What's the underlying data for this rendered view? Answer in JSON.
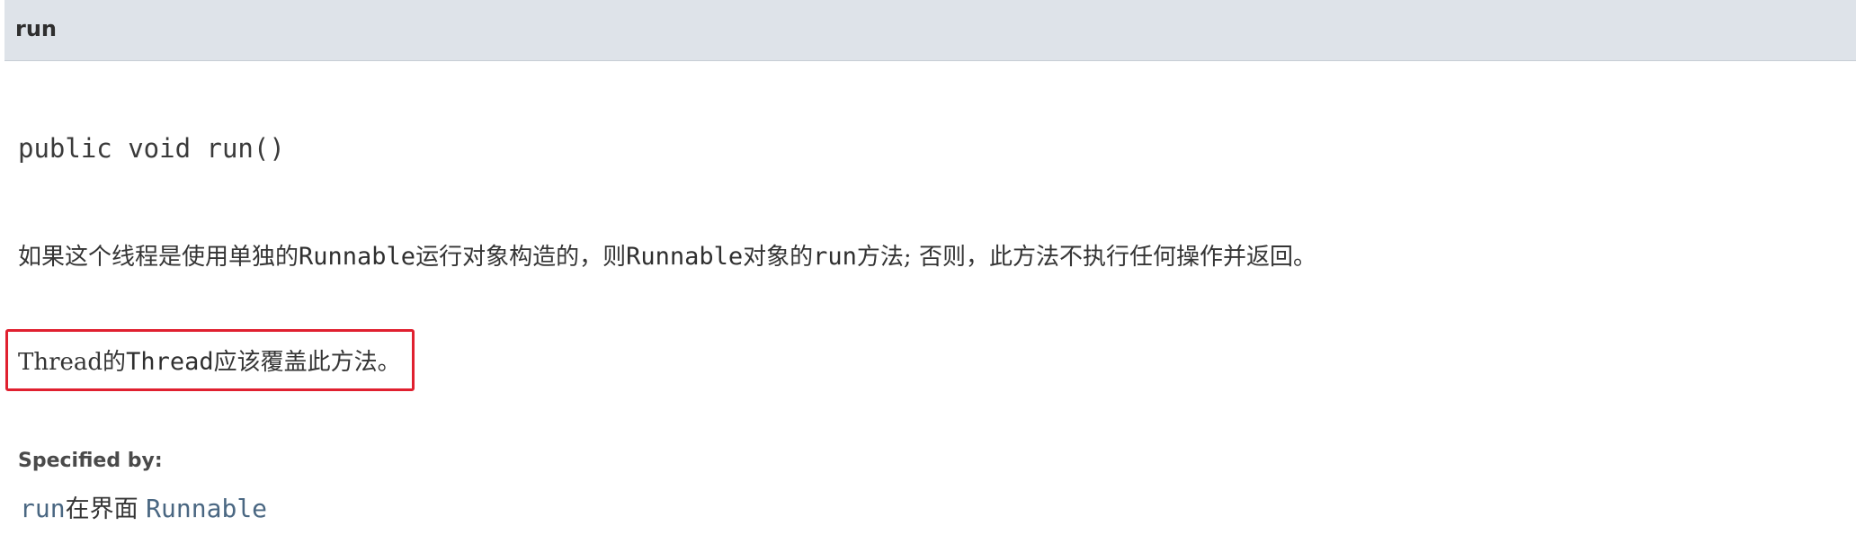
{
  "header": {
    "method_name": "run"
  },
  "signature": {
    "text": "public void run()"
  },
  "description": {
    "part1": "如果这个线程是使用单独的",
    "code1": "Runnable",
    "part2": "运行对象构造的，则",
    "code2": "Runnable",
    "part3": "对象的",
    "code3": "run",
    "part4": "方法; 否则，此方法不执行任何操作并返回。"
  },
  "note": {
    "part1": "Thread的",
    "code1": "Thread",
    "part2": "应该覆盖此方法。"
  },
  "specified_by": {
    "label": "Specified by:",
    "method_link": "run",
    "middle": "在界面 ",
    "interface_link": "Runnable"
  },
  "colors": {
    "header_bg": "#dee3e9",
    "highlight_border": "#e0202f",
    "link": "#4a6782"
  }
}
